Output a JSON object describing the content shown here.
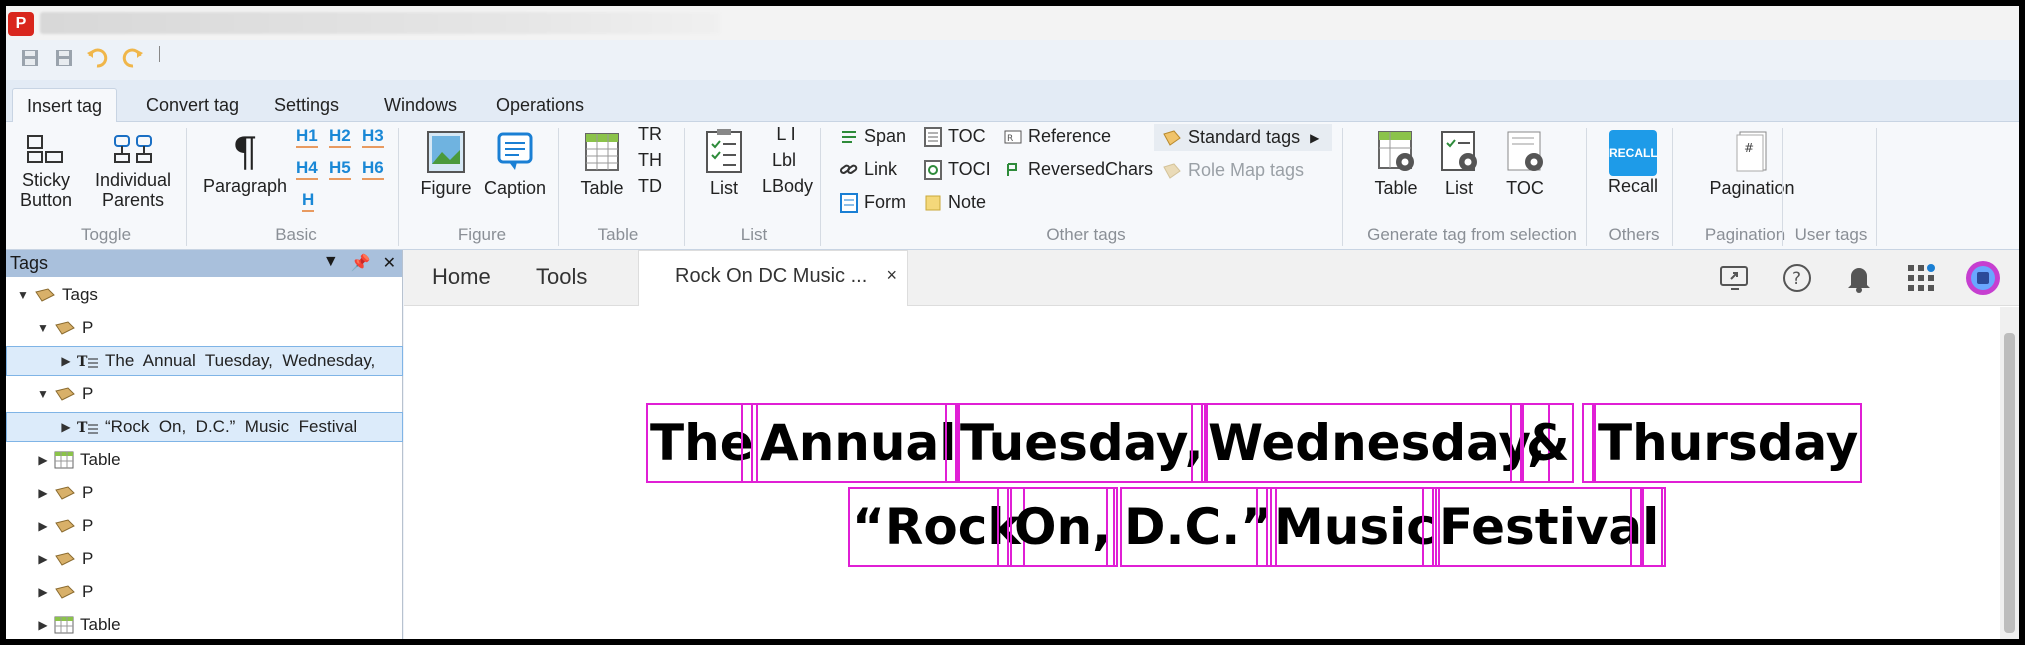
{
  "app": {
    "logo_letter": "P"
  },
  "ribbon_tabs": [
    "Insert tag",
    "Convert tag",
    "Settings",
    "Windows",
    "Operations"
  ],
  "ribbon": {
    "toggle": {
      "sticky": "Sticky\nButton",
      "individual": "Individual\nParents",
      "label": "Toggle"
    },
    "basic": {
      "paragraph": "Paragraph",
      "h1": "H1",
      "h2": "H2",
      "h3": "H3",
      "h4": "H4",
      "h5": "H5",
      "h6": "H6",
      "h": "H",
      "label": "Basic"
    },
    "figure": {
      "figure": "Figure",
      "caption": "Caption",
      "label": "Figure"
    },
    "table": {
      "table": "Table",
      "tr": "TR",
      "th": "TH",
      "td": "TD",
      "label": "Table"
    },
    "list": {
      "list": "List",
      "li": "L I",
      "lbl": "Lbl",
      "lbody": "LBody",
      "label": "List"
    },
    "other": {
      "span": "Span",
      "link": "Link",
      "form": "Form",
      "toc": "TOC",
      "toci": "TOCI",
      "note": "Note",
      "reference": "Reference",
      "reversedchars": "ReversedChars",
      "standard_tags": "Standard tags",
      "role_map_tags": "Role Map tags",
      "label": "Other tags"
    },
    "generate": {
      "table": "Table",
      "list": "List",
      "toc": "TOC",
      "label": "Generate tag from selection"
    },
    "others": {
      "recall": "Recall",
      "recall_badge": "RECALL",
      "label": "Others"
    },
    "pagination": {
      "pagination": "Pagination",
      "label": "Pagination"
    },
    "user_tags": {
      "label": "User tags"
    }
  },
  "tags_panel": {
    "title": "Tags",
    "rows": [
      {
        "label": "Tags"
      },
      {
        "label": "P"
      },
      {
        "label": "The  Annual  Tuesday,  Wednesday,"
      },
      {
        "label": "P"
      },
      {
        "label": "“Rock  On,  D.C.”  Music  Festival"
      },
      {
        "label": "Table"
      },
      {
        "label": "P"
      },
      {
        "label": "P"
      },
      {
        "label": "P"
      },
      {
        "label": "P"
      },
      {
        "label": "Table"
      }
    ]
  },
  "doc": {
    "home": "Home",
    "tools": "Tools",
    "file_tab": "Rock On DC Music ...",
    "close": "×",
    "line1": [
      "The",
      "Annual",
      "Tuesday,",
      "Wednesday,",
      "&",
      "Thursday"
    ],
    "line2": [
      "“Rock",
      "On,",
      "D.C.”",
      "Music",
      "Festival"
    ]
  },
  "colors": {
    "tag_box": "#e01fd5",
    "panel_header": "#a9c0dc",
    "selection": "#dcebfa",
    "recall": "#1e9be8"
  }
}
